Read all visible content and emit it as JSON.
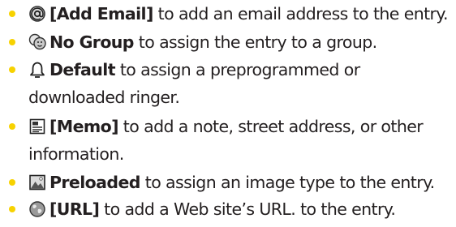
{
  "bullet_color": "#f7d200",
  "items": [
    {
      "icon": "at-sign-icon",
      "term": "[Add Email]",
      "rest": " to add an email address to the entry."
    },
    {
      "icon": "group-icon",
      "term": "No Group",
      "rest": " to assign the entry to a group."
    },
    {
      "icon": "bell-icon",
      "term": "Default",
      "rest": " to assign a preprogrammed or downloaded ringer."
    },
    {
      "icon": "memo-icon",
      "term": "[Memo]",
      "rest": " to add a note, street address, or other information."
    },
    {
      "icon": "image-icon",
      "term": "Preloaded",
      "rest": " to assign an image type to the entry."
    },
    {
      "icon": "globe-icon",
      "term": "[URL]",
      "rest": " to add a Web site’s URL. to the entry."
    }
  ]
}
